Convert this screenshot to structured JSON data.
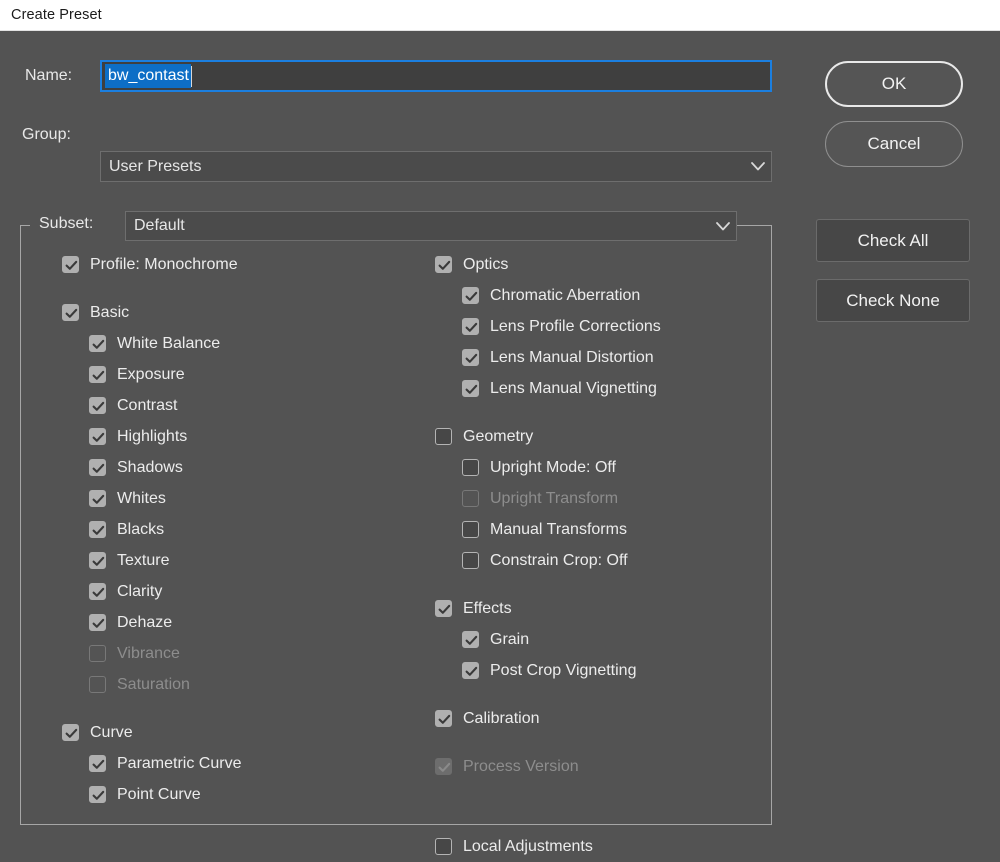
{
  "window": {
    "title": "Create Preset"
  },
  "form": {
    "name_label": "Name:",
    "name_value": "bw_contast",
    "group_label": "Group:",
    "group_value": "User Presets",
    "subset_label": "Subset:",
    "subset_value": "Default"
  },
  "buttons": {
    "ok": "OK",
    "cancel": "Cancel",
    "check_all": "Check All",
    "check_none": "Check None"
  },
  "icons": {
    "chevron_down": "chevron-down-icon",
    "check": "check-icon"
  },
  "colors": {
    "dialog_bg": "#535353",
    "titlebar_bg": "#ffffff",
    "accent_focus_border": "#1b7fe0",
    "selection_blue": "#0d6ec6",
    "checkbox_on": "#b0b0b0",
    "checkbox_off_bg": "#474747",
    "text": "#ececec",
    "text_disabled": "#8d8d8d",
    "groupbox_border": "#a6a6a6"
  },
  "left_column": [
    {
      "label": "Profile: Monochrome",
      "checked": true,
      "enabled": true,
      "indent": false,
      "gap": false
    },
    {
      "label": "Basic",
      "checked": true,
      "enabled": true,
      "indent": false,
      "gap": true
    },
    {
      "label": "White Balance",
      "checked": true,
      "enabled": true,
      "indent": true,
      "gap": false
    },
    {
      "label": "Exposure",
      "checked": true,
      "enabled": true,
      "indent": true,
      "gap": false
    },
    {
      "label": "Contrast",
      "checked": true,
      "enabled": true,
      "indent": true,
      "gap": false
    },
    {
      "label": "Highlights",
      "checked": true,
      "enabled": true,
      "indent": true,
      "gap": false
    },
    {
      "label": "Shadows",
      "checked": true,
      "enabled": true,
      "indent": true,
      "gap": false
    },
    {
      "label": "Whites",
      "checked": true,
      "enabled": true,
      "indent": true,
      "gap": false
    },
    {
      "label": "Blacks",
      "checked": true,
      "enabled": true,
      "indent": true,
      "gap": false
    },
    {
      "label": "Texture",
      "checked": true,
      "enabled": true,
      "indent": true,
      "gap": false
    },
    {
      "label": "Clarity",
      "checked": true,
      "enabled": true,
      "indent": true,
      "gap": false
    },
    {
      "label": "Dehaze",
      "checked": true,
      "enabled": true,
      "indent": true,
      "gap": false
    },
    {
      "label": "Vibrance",
      "checked": false,
      "enabled": false,
      "indent": true,
      "gap": false
    },
    {
      "label": "Saturation",
      "checked": false,
      "enabled": false,
      "indent": true,
      "gap": false
    },
    {
      "label": "Curve",
      "checked": true,
      "enabled": true,
      "indent": false,
      "gap": true
    },
    {
      "label": "Parametric Curve",
      "checked": true,
      "enabled": true,
      "indent": true,
      "gap": false
    },
    {
      "label": "Point Curve",
      "checked": true,
      "enabled": true,
      "indent": true,
      "gap": false
    }
  ],
  "right_column": [
    {
      "label": "Optics",
      "checked": true,
      "enabled": true,
      "indent": false,
      "gap": false
    },
    {
      "label": "Chromatic Aberration",
      "checked": true,
      "enabled": true,
      "indent": true,
      "gap": false
    },
    {
      "label": "Lens Profile Corrections",
      "checked": true,
      "enabled": true,
      "indent": true,
      "gap": false
    },
    {
      "label": "Lens Manual Distortion",
      "checked": true,
      "enabled": true,
      "indent": true,
      "gap": false
    },
    {
      "label": "Lens Manual Vignetting",
      "checked": true,
      "enabled": true,
      "indent": true,
      "gap": false
    },
    {
      "label": "Geometry",
      "checked": false,
      "enabled": true,
      "indent": false,
      "gap": true
    },
    {
      "label": "Upright Mode: Off",
      "checked": false,
      "enabled": true,
      "indent": true,
      "gap": false
    },
    {
      "label": "Upright Transform",
      "checked": false,
      "enabled": false,
      "indent": true,
      "gap": false
    },
    {
      "label": "Manual Transforms",
      "checked": false,
      "enabled": true,
      "indent": true,
      "gap": false
    },
    {
      "label": "Constrain Crop: Off",
      "checked": false,
      "enabled": true,
      "indent": true,
      "gap": false
    },
    {
      "label": "Effects",
      "checked": true,
      "enabled": true,
      "indent": false,
      "gap": true
    },
    {
      "label": "Grain",
      "checked": true,
      "enabled": true,
      "indent": true,
      "gap": false
    },
    {
      "label": "Post Crop Vignetting",
      "checked": true,
      "enabled": true,
      "indent": true,
      "gap": false
    },
    {
      "label": "Calibration",
      "checked": true,
      "enabled": true,
      "indent": false,
      "gap": true
    },
    {
      "label": "Process Version",
      "checked": true,
      "enabled": false,
      "indent": false,
      "gap": true
    }
  ],
  "clipped_item": {
    "label": "Local Adjustments",
    "checked": false,
    "enabled": true
  }
}
